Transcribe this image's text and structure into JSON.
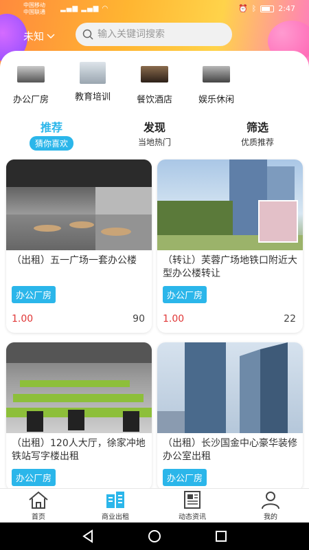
{
  "status_bar": {
    "carrier1": "中国移动",
    "carrier2": "中国联通",
    "time": "2:47"
  },
  "header": {
    "location": "未知",
    "search_placeholder": "输入关键词搜索"
  },
  "categories": [
    {
      "label": "办公厂房",
      "icon": "office-thumb"
    },
    {
      "label": "教育培训",
      "icon": "education-thumb"
    },
    {
      "label": "餐饮酒店",
      "icon": "restaurant-thumb"
    },
    {
      "label": "娱乐休闲",
      "icon": "leisure-thumb"
    }
  ],
  "tabs": [
    {
      "title": "推荐",
      "subtitle": "猜你喜欢",
      "active": true
    },
    {
      "title": "发现",
      "subtitle": "当地热门",
      "active": false
    },
    {
      "title": "筛选",
      "subtitle": "优质推荐",
      "active": false
    }
  ],
  "listings": [
    {
      "title": "（出租）五一广场一套办公楼",
      "tag": "办公厂房",
      "price": "1.00",
      "count": "90"
    },
    {
      "title": "（转让）芙蓉广场地铁口附近大型办公楼转让",
      "tag": "办公厂房",
      "price": "1.00",
      "count": "22"
    },
    {
      "title": "（出租）120人大厅，徐家冲地铁站写字楼出租",
      "tag": "办公厂房"
    },
    {
      "title": "（出租）长沙国金中心豪华装修办公室出租",
      "tag": "办公厂房"
    }
  ],
  "tabbar": [
    {
      "label": "首页",
      "icon": "home-icon"
    },
    {
      "label": "商业出租",
      "icon": "building-icon",
      "active": true
    },
    {
      "label": "动态资讯",
      "icon": "news-icon"
    },
    {
      "label": "我的",
      "icon": "user-icon"
    }
  ],
  "colors": {
    "accent": "#2bb6ea",
    "price": "#e03636"
  }
}
